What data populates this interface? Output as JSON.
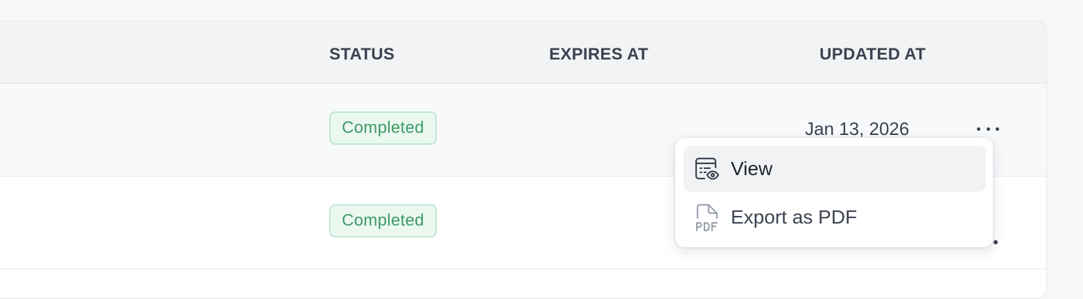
{
  "table": {
    "columns": {
      "status": "STATUS",
      "expires_at": "EXPIRES AT",
      "updated_at": "UPDATED AT"
    },
    "rows": [
      {
        "status": "Completed",
        "expires_at": "",
        "updated_at": "Jan 13, 2026"
      },
      {
        "status": "Completed",
        "expires_at": "",
        "updated_at": ""
      }
    ]
  },
  "row_menu": {
    "items": [
      {
        "label": "View",
        "icon": "eye-document-icon"
      },
      {
        "label": "Export as PDF",
        "icon": "pdf-file-icon"
      }
    ]
  },
  "colors": {
    "status_completed_text": "#3f9a66",
    "status_completed_bg": "#eaf8f0",
    "status_completed_border": "#bfe6d0",
    "header_bg": "#f2f3f5"
  }
}
